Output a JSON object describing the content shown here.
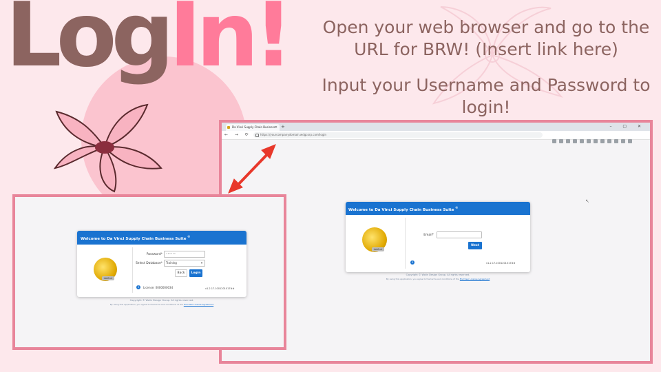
{
  "title": {
    "part1": "Log",
    "part2": "In!"
  },
  "instructions": [
    "Open your web browser and go to the URL for BRW! (Insert link here)",
    "Input your Username and Password to login!"
  ],
  "browser": {
    "tab_title": "Da Vinci Supply Chain Business",
    "url": "https://yourcompanydomain.wdgcorp.com/login",
    "window_controls": "– ▢ ✕",
    "nav_glyphs": "← → ⟳ ⌂",
    "card": {
      "heading": "Welcome to Da Vinci Supply Chain Business Suite",
      "email_label": "Email*",
      "email_value": "",
      "next_label": "Next",
      "version": "v1.2.17.1001201017##",
      "copyright": "Copyright © Wolin Design Group. All rights reserved.",
      "terms_prefix": "By using this application, you agree to the terms and conditions of the",
      "terms_link": "End User License Agreement"
    }
  },
  "zoom": {
    "card": {
      "heading": "Welcome to Da Vinci Supply Chain Business Suite",
      "password_label": "Password*",
      "password_placeholder": "••••••",
      "database_label": "Select Database*",
      "database_value": "Training",
      "back_label": "Back",
      "login_label": "Login",
      "license": "License: 0000000034",
      "version": "v1.2.17.1001201017##",
      "copyright": "Copyright © Wolin Design Group. All rights reserved.",
      "terms_prefix": "By using this application, you agree to the terms and conditions of the",
      "terms_link": "End User License Agreement"
    }
  },
  "coin_label": "daVinci",
  "colors": {
    "background": "#fde8ec",
    "title_brown": "#8c6460",
    "title_pink": "#ff7b9a",
    "frame_border": "#e8859a",
    "card_header": "#1a73d0",
    "arrow": "#e8382b"
  },
  "icons": [
    "flower-icon",
    "arrow-icon",
    "coin-logo-icon",
    "info-icon",
    "cursor-icon"
  ]
}
